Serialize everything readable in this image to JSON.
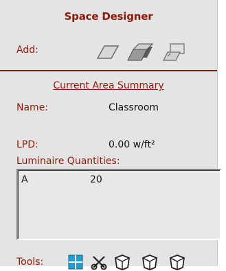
{
  "panel": {
    "title": "Space Designer",
    "add_label": "Add:",
    "add_icons": [
      "floor-plane-icon",
      "box-extrude-icon",
      "wall-plane-icon"
    ],
    "section_title": "Current Area Summary",
    "name_label": "Name:",
    "name_value": "Classroom",
    "lpd_label": "LPD:",
    "lpd_value": "0.00 w/ft²",
    "luminaire_label": "Luminaire Quantities:",
    "luminaires": [
      {
        "name": "A",
        "qty": "20"
      }
    ],
    "tools_label": "Tools:",
    "tools": [
      "grid-tool-icon",
      "scissors-icon",
      "view-cube-icon-1",
      "view-cube-icon-2",
      "view-cube-icon-3"
    ]
  },
  "colors": {
    "accent": "#8b1a0a",
    "panel_bg": "#e4e4e4",
    "grid_tool_bg": "#1e9fd6"
  }
}
